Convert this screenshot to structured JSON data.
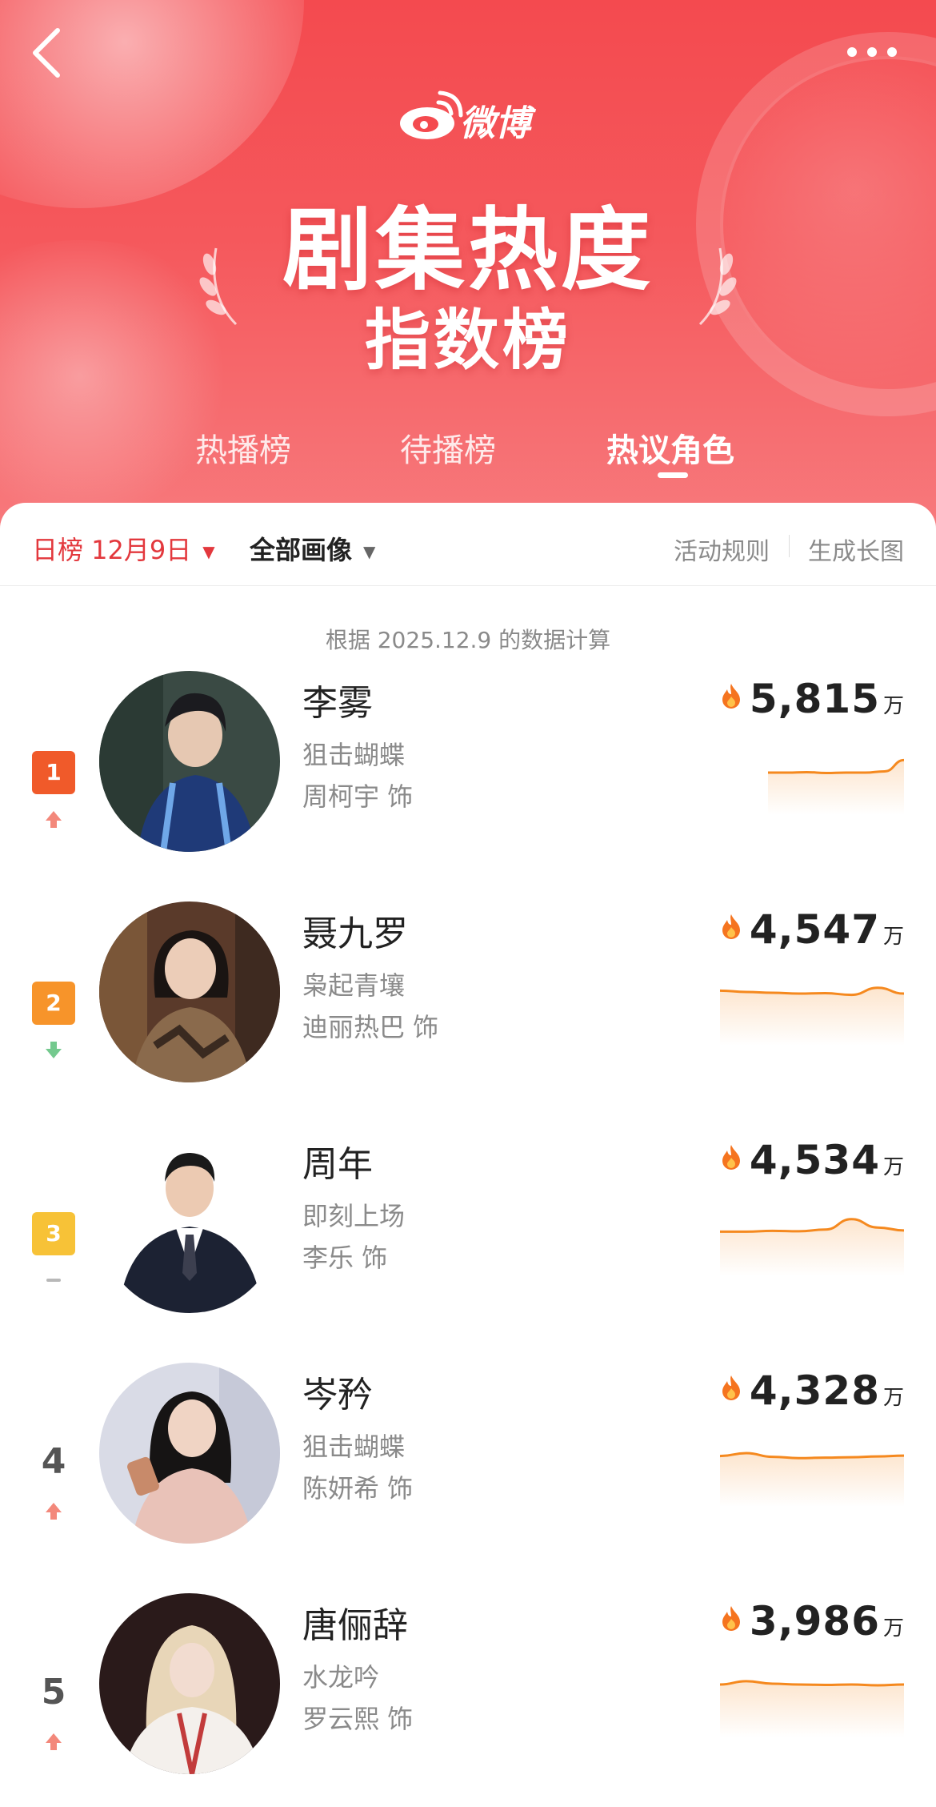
{
  "nav": {
    "back_icon": "chevron-left-icon",
    "more_icon": "more-dots-icon"
  },
  "brand": {
    "logo_text": "微博"
  },
  "banner": {
    "title": "剧集热度",
    "subtitle": "指数榜"
  },
  "tabs": [
    {
      "label": "热播榜",
      "active": false
    },
    {
      "label": "待播榜",
      "active": false
    },
    {
      "label": "热议角色",
      "active": true
    }
  ],
  "filters": {
    "date_label": "日榜 12月9日",
    "category_label": "全部画像",
    "rules_label": "活动规则",
    "generate_label": "生成长图"
  },
  "note": "根据 2025.12.9 的数据计算",
  "colors": {
    "brand_red": "#e3383d",
    "accent_orange": "#f5891f",
    "rank1": "#f05a2a",
    "rank2": "#f7942a",
    "rank3": "#f7c237",
    "up": "#f06a5a",
    "down": "#5cc07a"
  },
  "unit": "万",
  "actor_suffix": "饰",
  "items": [
    {
      "rank": "1",
      "badge": true,
      "trend": "up",
      "name": "李雾",
      "show": "狙击蝴蝶",
      "actor": "周柯宇 饰",
      "score": "5,815",
      "spark": [
        0.25,
        0.25,
        0.26,
        0.24,
        0.25,
        0.25,
        0.28,
        0.55
      ]
    },
    {
      "rank": "2",
      "badge": true,
      "trend": "down",
      "name": "聂九罗",
      "show": "枭起青壤",
      "actor": "迪丽热巴 饰",
      "score": "4,547",
      "spark": [
        0.55,
        0.52,
        0.5,
        0.48,
        0.49,
        0.45,
        0.62,
        0.48
      ]
    },
    {
      "rank": "3",
      "badge": true,
      "trend": "flat",
      "name": "周年",
      "show": "即刻上场",
      "actor": "李乐 饰",
      "score": "4,534",
      "spark": [
        0.3,
        0.3,
        0.32,
        0.31,
        0.35,
        0.6,
        0.4,
        0.33
      ]
    },
    {
      "rank": "4",
      "badge": false,
      "trend": "up",
      "name": "岑矜",
      "show": "狙击蝴蝶",
      "actor": "陈妍希 饰",
      "score": "4,328",
      "spark": [
        0.45,
        0.52,
        0.43,
        0.4,
        0.41,
        0.42,
        0.44,
        0.46
      ]
    },
    {
      "rank": "5",
      "badge": false,
      "trend": "up",
      "name": "唐俪辞",
      "show": "水龙吟",
      "actor": "罗云熙 饰",
      "score": "3,986",
      "spark": [
        0.5,
        0.58,
        0.52,
        0.5,
        0.49,
        0.5,
        0.48,
        0.5
      ]
    }
  ]
}
